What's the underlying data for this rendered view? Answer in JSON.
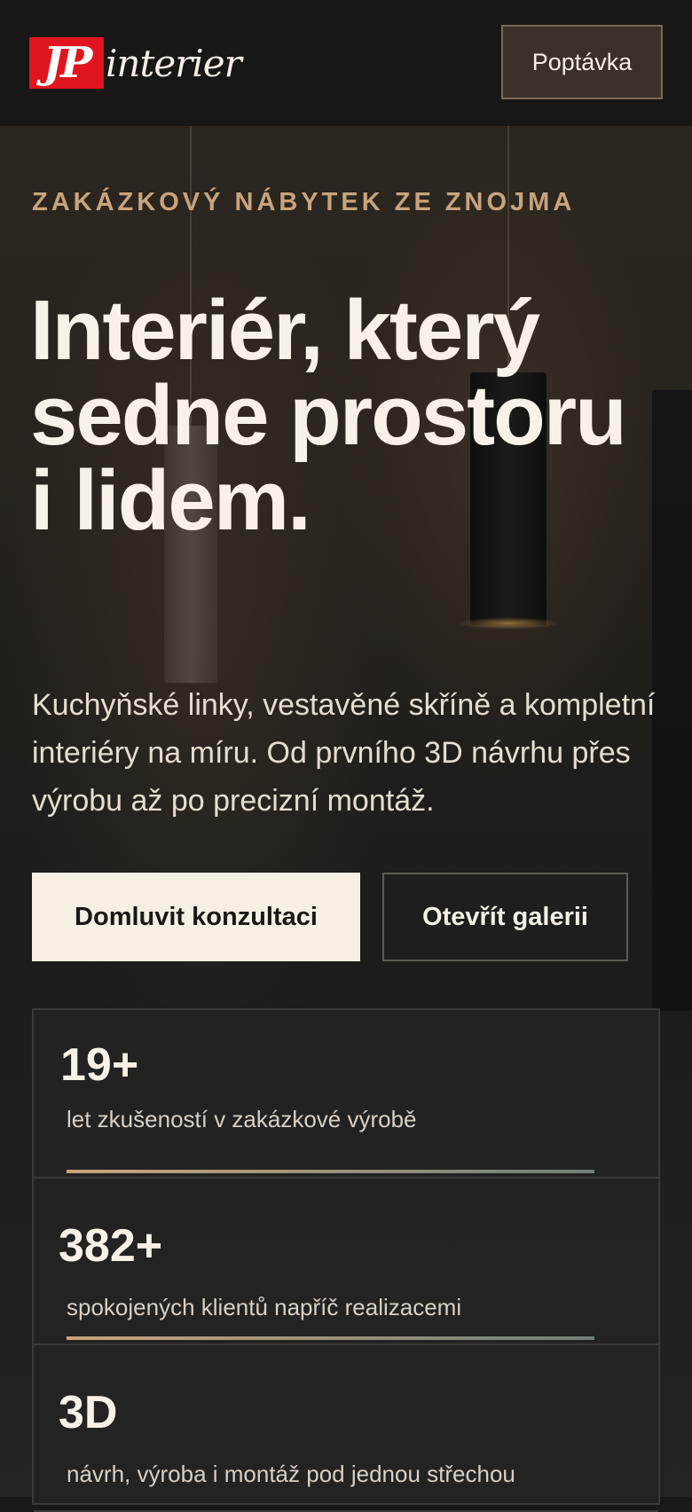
{
  "header": {
    "logo_initials": "JP",
    "logo_word": "interier",
    "cta_label": "Poptávka"
  },
  "hero": {
    "eyebrow": "ZAKÁZKOVÝ NÁBYTEK ZE ZNOJMA",
    "headline": "Interiér, který sedne prostoru i lidem.",
    "lede": "Kuchyňské linky, vestavěné skříně a kompletní interiéry na míru. Od prvního 3D návrhu přes výrobu až po precizní montáž.",
    "primary_button": "Domluvit konzultaci",
    "secondary_button": "Otevřít galerii"
  },
  "stats": [
    {
      "value": "19+",
      "label": "let zkušeností v zakázkové výrobě"
    },
    {
      "value": "382+",
      "label": "spokojených klientů napříč realizacemi"
    },
    {
      "value": "3D",
      "label": "návrh, výroba i montáž pod jednou střechou"
    }
  ],
  "colors": {
    "accent": "#c8a47c",
    "brand_red": "#e0151f",
    "background": "#1a1917",
    "text": "#f5efe6"
  }
}
